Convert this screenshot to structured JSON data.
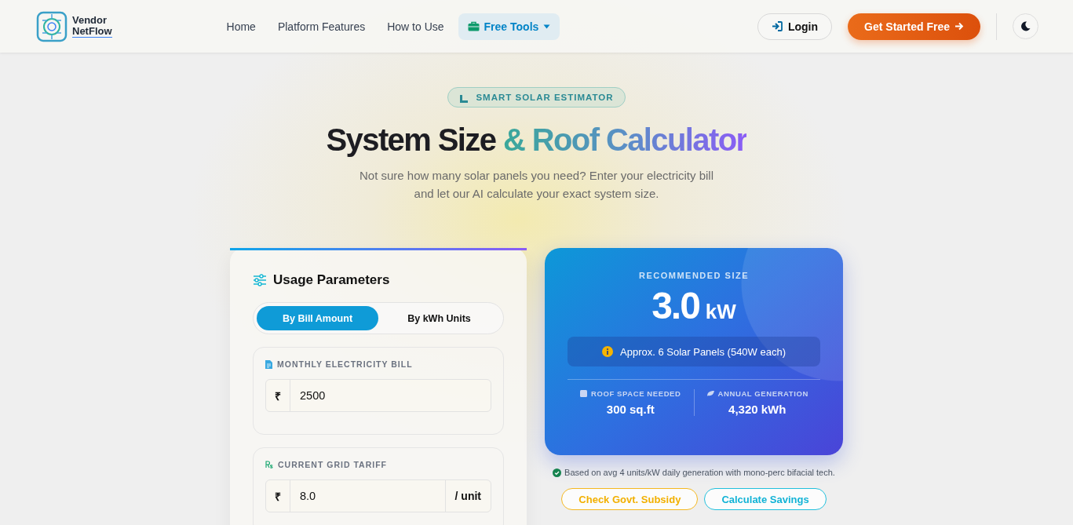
{
  "header": {
    "logo_lines": [
      "Vendor",
      "NetFlow"
    ],
    "nav": [
      {
        "label": "Home",
        "selected": false,
        "dropdown": false
      },
      {
        "label": "Platform Features",
        "selected": false,
        "dropdown": false
      },
      {
        "label": "How to Use",
        "selected": false,
        "dropdown": false
      },
      {
        "label": "Free Tools",
        "selected": true,
        "dropdown": true
      }
    ],
    "login": "Login",
    "cta": "Get Started Free"
  },
  "hero": {
    "badge": "SMART SOLAR ESTIMATOR",
    "title_plain": "System Size",
    "title_accent": "& Roof Calculator",
    "subtitle": "Not sure how many solar panels you need? Enter your electricity bill and let our AI calculate your exact system size."
  },
  "parameters": {
    "title": "Usage Parameters",
    "modes": [
      {
        "label": "By Bill Amount",
        "selected": true
      },
      {
        "label": "By kWh Units",
        "selected": false
      }
    ],
    "fields": [
      {
        "kind": "bill",
        "label": "MONTHLY ELECTRICITY BILL",
        "prefix": "₹",
        "value": "2500"
      },
      {
        "kind": "tariff",
        "label": "CURRENT GRID TARIFF",
        "prefix": "₹",
        "value": "8.0",
        "suffix": "/ unit"
      }
    ]
  },
  "result": {
    "label": "RECOMMENDED SIZE",
    "value": "3.0",
    "unit": "kW",
    "panels_note": "Approx. 6 Solar Panels (540W each)",
    "stats": [
      {
        "kind": "roof",
        "label": "ROOF SPACE NEEDED",
        "value": "300 sq.ft"
      },
      {
        "kind": "energy",
        "label": "ANNUAL GENERATION",
        "value": "4,320 kWh"
      }
    ]
  },
  "footnote": "Based on avg 4 units/kW daily generation with mono-perc bifacial tech.",
  "actions": [
    {
      "kind": "subsidy",
      "label": "Check Govt. Subsidy"
    },
    {
      "kind": "savings",
      "label": "Calculate Savings"
    }
  ]
}
